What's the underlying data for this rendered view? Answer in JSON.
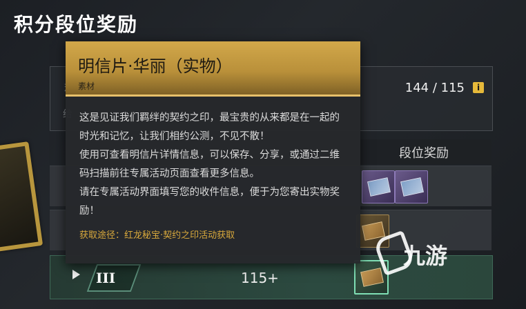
{
  "page": {
    "title": "积分段位奖励"
  },
  "panel": {
    "score": "144 / 115",
    "info_icon": "i",
    "fragment_label": "积分",
    "fragment_line": "给"
  },
  "table": {
    "reward_header": "段位奖励",
    "rows": [
      {
        "rank": "",
        "score": ""
      },
      {
        "rank": "",
        "score": ""
      },
      {
        "rank": "III",
        "score": "115+"
      }
    ]
  },
  "tooltip": {
    "title": "明信片·华丽（实物）",
    "category": "素材",
    "description": [
      "这是见证我们羁绊的契约之印，最宝贵的从来都是在一起的时光和记忆，让我们相约公测，不见不散！",
      "使用可查看明信片详情信息，可以保存、分享，或通过二维码扫描前往专属活动页面查看更多信息。",
      "请在专属活动界面填写您的收件信息，便于为您寄出实物奖励！"
    ],
    "source": "获取途径：红龙秘宝·契约之印活动获取"
  },
  "watermark": {
    "text": "九游",
    "logo_icon": "jiuyou-logo-icon"
  },
  "colors": {
    "tooltip_header": "#c9a045",
    "source_text": "#d9a93c",
    "selected_row": "#2c4a40"
  }
}
